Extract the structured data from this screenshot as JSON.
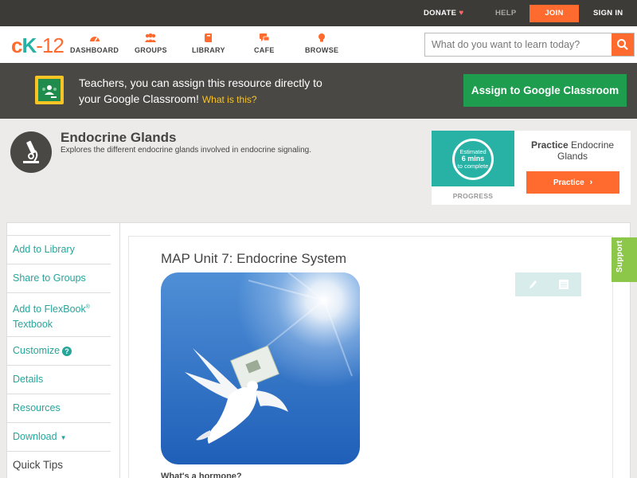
{
  "topbar": {
    "donate": "DONATE",
    "help": "HELP",
    "join": "JOIN",
    "signin": "SIGN IN"
  },
  "logo": {
    "c": "c",
    "k": "K",
    "n": "-12"
  },
  "nav": {
    "dashboard": "DASHBOARD",
    "groups": "GROUPS",
    "library": "LIBRARY",
    "cafe": "CAFE",
    "browse": "BROWSE"
  },
  "search": {
    "placeholder": "What do you want to learn today?"
  },
  "banner": {
    "line1": "Teachers, you can assign this resource directly to",
    "line2": "your Google Classroom!",
    "what": "What is this?",
    "assign": "Assign to Google Classroom"
  },
  "concept": {
    "title": "Endocrine Glands",
    "description": "Explores the different endocrine glands involved in endocrine signaling."
  },
  "practice": {
    "estimated": "Estimated",
    "mins": "6 mins",
    "complete": "to complete",
    "progress": "PROGRESS",
    "practice_word": "Practice",
    "topic": "Endocrine Glands",
    "button": "Practice"
  },
  "sidebar": {
    "add_library": "Add to Library",
    "share_groups": "Share to Groups",
    "add_flexbook": "Add to FlexBook",
    "reg": "®",
    "textbook": "Textbook",
    "customize": "Customize",
    "help_q": "?",
    "details": "Details",
    "resources": "Resources",
    "download": "Download",
    "download_arrow": "▼",
    "quick_tips": "Quick Tips"
  },
  "document": {
    "title": "MAP Unit 7: Endocrine System",
    "subheading": "What's a hormone?"
  },
  "support": "Support",
  "colors": {
    "accent": "#ff6a2f",
    "teal": "#27b2a5",
    "banner_bg": "#4a4845",
    "green": "#1f9d4f",
    "support": "#8cc74a"
  }
}
